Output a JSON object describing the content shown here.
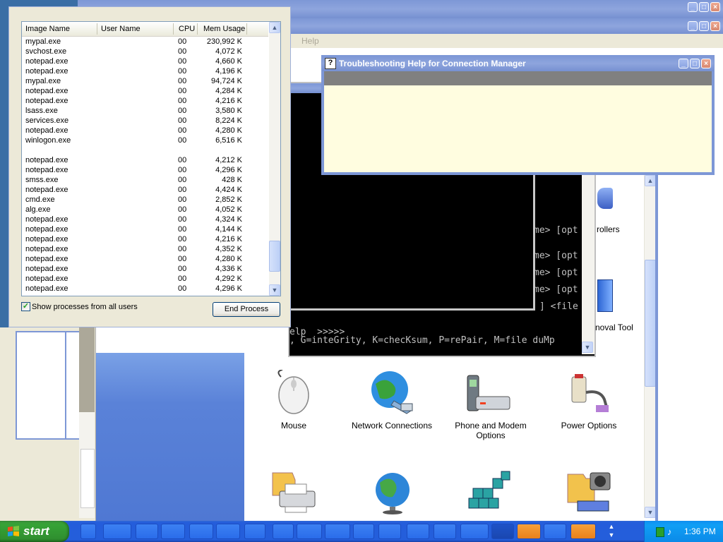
{
  "taskmgr": {
    "columns": [
      "Image Name",
      "User Name",
      "CPU",
      "Mem Usage"
    ],
    "rows": [
      [
        "mypal.exe",
        "00",
        "230,992 K"
      ],
      [
        "svchost.exe",
        "00",
        "4,072 K"
      ],
      [
        "notepad.exe",
        "00",
        "4,660 K"
      ],
      [
        "notepad.exe",
        "00",
        "4,196 K"
      ],
      [
        "mypal.exe",
        "00",
        "94,724 K"
      ],
      [
        "notepad.exe",
        "00",
        "4,284 K"
      ],
      [
        "notepad.exe",
        "00",
        "4,216 K"
      ],
      [
        "lsass.exe",
        "00",
        "3,580 K"
      ],
      [
        "services.exe",
        "00",
        "8,224 K"
      ],
      [
        "notepad.exe",
        "00",
        "4,280 K"
      ],
      [
        "winlogon.exe",
        "00",
        "6,516 K"
      ],
      [
        "",
        "",
        ""
      ],
      [
        "notepad.exe",
        "00",
        "4,212 K"
      ],
      [
        "notepad.exe",
        "00",
        "4,296 K"
      ],
      [
        "smss.exe",
        "00",
        "428 K"
      ],
      [
        "notepad.exe",
        "00",
        "4,424 K"
      ],
      [
        "cmd.exe",
        "00",
        "2,852 K"
      ],
      [
        "alg.exe",
        "00",
        "4,052 K"
      ],
      [
        "notepad.exe",
        "00",
        "4,324 K"
      ],
      [
        "notepad.exe",
        "00",
        "4,144 K"
      ],
      [
        "notepad.exe",
        "00",
        "4,216 K"
      ],
      [
        "notepad.exe",
        "00",
        "4,352 K"
      ],
      [
        "notepad.exe",
        "00",
        "4,280 K"
      ],
      [
        "notepad.exe",
        "00",
        "4,336 K"
      ],
      [
        "notepad.exe",
        "00",
        "4,292 K"
      ],
      [
        "notepad.exe",
        "00",
        "4,296 K"
      ]
    ],
    "show_all_label": "Show processes from all users",
    "show_all_checked": true,
    "end_process_label": "End Process"
  },
  "help_window": {
    "title": "Troubleshooting Help for Connection Manager"
  },
  "background_menu": {
    "help": "Help"
  },
  "console": {
    "lines": [
      "me> [opt",
      "me> [opt",
      "me> [opt",
      "me> [opt",
      "] <file",
      "elp  >>>>>",
      ", G=inteGrity, K=checKsum, P=rePair, M=file duMp"
    ]
  },
  "control_panel": {
    "partial_labels": [
      "rollers",
      "noval Tool"
    ],
    "items": [
      "Mouse",
      "Network Connections",
      "Phone and Modem Options",
      "Power Options"
    ]
  },
  "taskbar": {
    "start_label": "start",
    "clock": "1:36 PM"
  },
  "colors": {
    "help_body": "#fffde0",
    "help_strip": "#808080",
    "cp_sidebar": "#5a82d8"
  }
}
